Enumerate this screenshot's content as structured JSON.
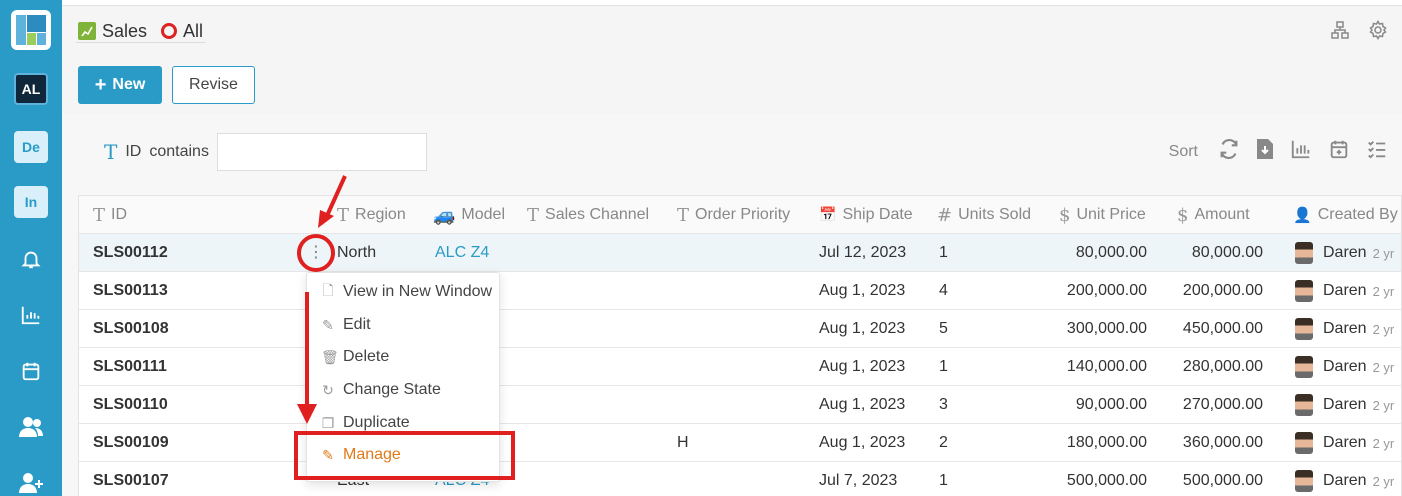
{
  "sidebar": {
    "badges": [
      "AL",
      "De",
      "In"
    ],
    "icons": [
      "bell-icon",
      "chart-icon",
      "calendar-icon",
      "users-icon",
      "add-user-icon"
    ]
  },
  "header": {
    "app_name": "Sales",
    "filter_name": "All"
  },
  "toolbar": {
    "new_label": "New",
    "revise_label": "Revise",
    "sort_label": "Sort"
  },
  "filter": {
    "field": "ID",
    "operator": "contains",
    "value": ""
  },
  "table": {
    "columns": [
      "ID",
      "Region",
      "Model",
      "Sales Channel",
      "Order Priority",
      "Ship Date",
      "Units Sold",
      "Unit Price",
      "Amount",
      "Created By"
    ],
    "rows": [
      {
        "id": "SLS00112",
        "region": "North",
        "model": "ALC Z4",
        "channel": "",
        "priority": "",
        "ship": "Jul 12, 2023",
        "units": "1",
        "price": "80,000.00",
        "amount": "80,000.00",
        "by": "Daren",
        "age": "2 yr"
      },
      {
        "id": "SLS00113",
        "region": "",
        "model": "",
        "channel": "",
        "priority": "",
        "ship": "Aug 1, 2023",
        "units": "4",
        "price": "200,000.00",
        "amount": "200,000.00",
        "by": "Daren",
        "age": "2 yr"
      },
      {
        "id": "SLS00108",
        "region": "",
        "model": "",
        "channel": "",
        "priority": "",
        "ship": "Aug 1, 2023",
        "units": "5",
        "price": "300,000.00",
        "amount": "450,000.00",
        "by": "Daren",
        "age": "2 yr"
      },
      {
        "id": "SLS00111",
        "region": "",
        "model": "",
        "channel": "",
        "priority": "",
        "ship": "Aug 1, 2023",
        "units": "1",
        "price": "140,000.00",
        "amount": "280,000.00",
        "by": "Daren",
        "age": "2 yr"
      },
      {
        "id": "SLS00110",
        "region": "",
        "model": "",
        "channel": "",
        "priority": "",
        "ship": "Aug 1, 2023",
        "units": "3",
        "price": "90,000.00",
        "amount": "270,000.00",
        "by": "Daren",
        "age": "2 yr"
      },
      {
        "id": "SLS00109",
        "region": "",
        "model": "",
        "channel": "",
        "priority": "H",
        "ship": "Aug 1, 2023",
        "units": "2",
        "price": "180,000.00",
        "amount": "360,000.00",
        "by": "Daren",
        "age": "2 yr"
      },
      {
        "id": "SLS00107",
        "region": "East",
        "model": "ALC Z4",
        "channel": "",
        "priority": "",
        "ship": "Jul 7, 2023",
        "units": "1",
        "price": "500,000.00",
        "amount": "500,000.00",
        "by": "Daren",
        "age": "2 yr"
      }
    ]
  },
  "context_menu": {
    "items": [
      "View in New Window",
      "Edit",
      "Delete",
      "Change State",
      "Duplicate",
      "Manage"
    ]
  },
  "colors": {
    "accent": "#2a9bc6",
    "annotation": "#e02020",
    "manage": "#e07a18"
  }
}
